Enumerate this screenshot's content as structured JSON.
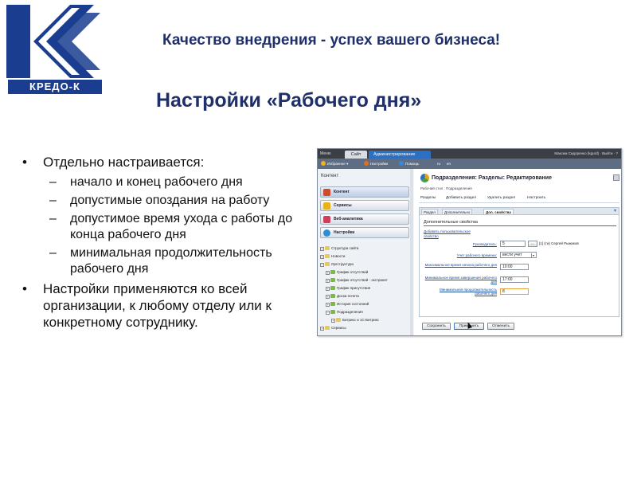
{
  "brand": {
    "logo_text": "КРЕДО-К",
    "tagline": "Качество внедрения - успех вашего бизнеса!",
    "colors": {
      "primary": "#1a3d8f",
      "accent": "#2d6fc0"
    }
  },
  "slide": {
    "title": "Настройки «Рабочего дня»",
    "bullet_marker": "•",
    "sub_marker": "–",
    "bullets": [
      {
        "text": "Отдельно настраивается:",
        "sub": [
          "начало и конец рабочего дня",
          "допустимые опоздания на работу",
          "допустимое время ухода с работы до конца рабочего дня",
          "минимальная продолжительность рабочего дня"
        ]
      },
      {
        "text": "Настройки применяются ко всей организации, к любому отделу или к конкретному сотруднику."
      }
    ]
  },
  "app": {
    "top": {
      "menu_label": "Меню",
      "tab_site": "Сайт",
      "tab_admin": "Администрирование",
      "user_text": "Максим Сидоренко (kgurd) · Выйти · ?"
    },
    "bar": {
      "favorites": "Избранное",
      "settings": "Настройки",
      "help": "Помощь",
      "lang": "ru",
      "lang2": "en"
    },
    "sidebar": {
      "title": "Контент",
      "buttons": [
        "Контент",
        "Сервисы",
        "Веб-аналитика",
        "Настройки"
      ],
      "tree": [
        {
          "label": "Структура сайта",
          "level": 0
        },
        {
          "label": "Новости",
          "level": 0
        },
        {
          "label": "Оргструктура",
          "level": 0
        },
        {
          "label": "График отсутствий",
          "level": 1
        },
        {
          "label": "График отсутствий - экстранет",
          "level": 1
        },
        {
          "label": "График присутствия",
          "level": 1
        },
        {
          "label": "Доска почета",
          "level": 1
        },
        {
          "label": "История состояний",
          "level": 1
        },
        {
          "label": "Подразделения",
          "level": 1
        },
        {
          "label": "Битрикс и 1С-Битрикс",
          "level": 2
        },
        {
          "label": "Сервисы",
          "level": 0
        }
      ]
    },
    "main": {
      "title": "Подразделения: Разделы: Редактирование",
      "breadcrumb": "Рабочий стол : Подразделения",
      "toolbar": [
        "Разделы",
        "Добавить раздел",
        "Удалить раздел",
        "Настроить"
      ],
      "tabs": [
        "Раздел",
        "Дополнительно",
        "Доп. свойства"
      ],
      "section_title": "Дополнительные свойства",
      "add_link": "Добавить пользовательское свойство",
      "fields": {
        "head_label": "Руководитель:",
        "head_value": "5",
        "head_name": "[1] (ти) Сергей Рыжиков",
        "accounting_label": "Учет рабочего времени:",
        "accounting_value": "вести учет",
        "start_label": "Максимальное время начала рабочего дня",
        "start_value": "10:00",
        "end_label": "Минимальное время завершения рабочего дня",
        "end_value": "17:00",
        "duration_label": "Минимальная продолжительность рабочего дня",
        "duration_value": "8"
      },
      "buttons": {
        "save": "Сохранить",
        "apply": "Применить",
        "cancel": "Отменить"
      }
    }
  }
}
